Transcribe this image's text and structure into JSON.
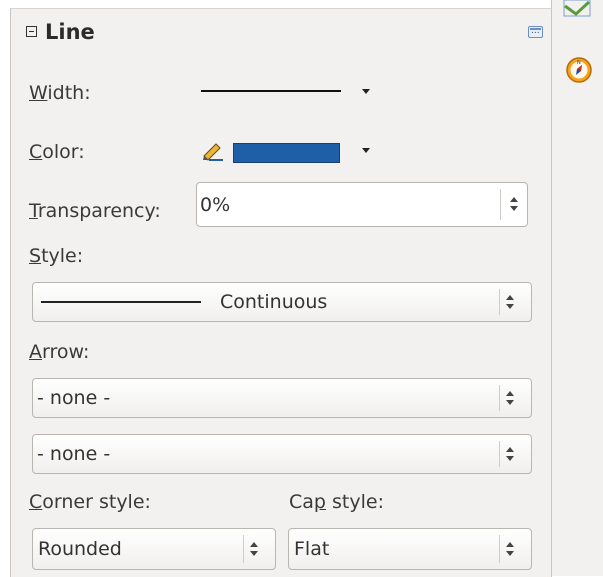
{
  "panel": {
    "title": "Line",
    "width_label": "Width:",
    "color_label": "Color:",
    "transparency_label": "Transparency:",
    "transparency_value": "0%",
    "style_label": "Style:",
    "style_value": "Continuous",
    "arrow_label": "Arrow:",
    "arrow_start_value": "- none -",
    "arrow_end_value": "- none -",
    "corner_style_label": "Corner style:",
    "corner_style_value": "Rounded",
    "cap_style_label": "Cap style:",
    "cap_style_value": "Flat"
  },
  "colors": {
    "line_color": "#1f5fa8",
    "panel_background": "#f2f1f0"
  },
  "icons": [
    "collapse-icon",
    "more-options-icon",
    "pencil-icon",
    "gallery-icon",
    "navigator-icon"
  ]
}
